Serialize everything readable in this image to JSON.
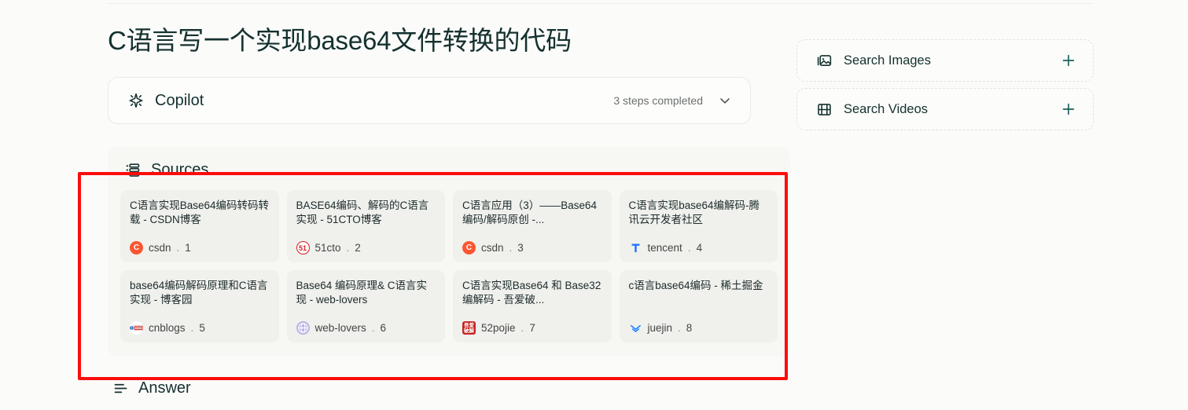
{
  "page": {
    "title": "C语言写一个实现base64文件转换的代码",
    "background_color": "#fbfbf9",
    "highlight_color": "#fb0d0d"
  },
  "copilot": {
    "icon": "sparkle-icon",
    "label": "Copilot",
    "steps_status": "3 steps completed",
    "expand_icon": "chevron-down-icon"
  },
  "sources": {
    "icon": "list-icon",
    "title": "Sources",
    "cards": [
      {
        "title": "C语言实现Base64编码转码转载 - CSDN博客",
        "domain": "csdn",
        "separator": ".",
        "number": "1",
        "favicon": "csdn-favicon"
      },
      {
        "title": "BASE64编码、解码的C语言实现 - 51CTO博客",
        "domain": "51cto",
        "separator": ".",
        "number": "2",
        "favicon": "51cto-favicon"
      },
      {
        "title": "C语言应用（3）——Base64编码/解码原创 -...",
        "domain": "csdn",
        "separator": ".",
        "number": "3",
        "favicon": "csdn-favicon"
      },
      {
        "title": "C语言实现base64编解码-腾讯云开发者社区",
        "domain": "tencent",
        "separator": ".",
        "number": "4",
        "favicon": "tencent-favicon"
      },
      {
        "title": "base64编码解码原理和C语言实现 - 博客园",
        "domain": "cnblogs",
        "separator": ".",
        "number": "5",
        "favicon": "cnblogs-favicon"
      },
      {
        "title": "Base64 编码原理& C语言实现 - web-lovers",
        "domain": "web-lovers",
        "separator": ".",
        "number": "6",
        "favicon": "web-lovers-favicon"
      },
      {
        "title": "C语言实现Base64 和 Base32 编解码 - 吾爱破...",
        "domain": "52pojie",
        "separator": ".",
        "number": "7",
        "favicon": "52pojie-favicon"
      },
      {
        "title": "c语言base64编码 - 稀土掘金",
        "domain": "juejin",
        "separator": ".",
        "number": "8",
        "favicon": "juejin-favicon"
      }
    ]
  },
  "answer": {
    "icon": "answer-icon",
    "title": "Answer"
  },
  "sidebar": {
    "cards": [
      {
        "icon": "image-icon",
        "label": "Search Images",
        "action_icon": "plus-icon"
      },
      {
        "icon": "video-grid-icon",
        "label": "Search Videos",
        "action_icon": "plus-icon"
      }
    ]
  }
}
